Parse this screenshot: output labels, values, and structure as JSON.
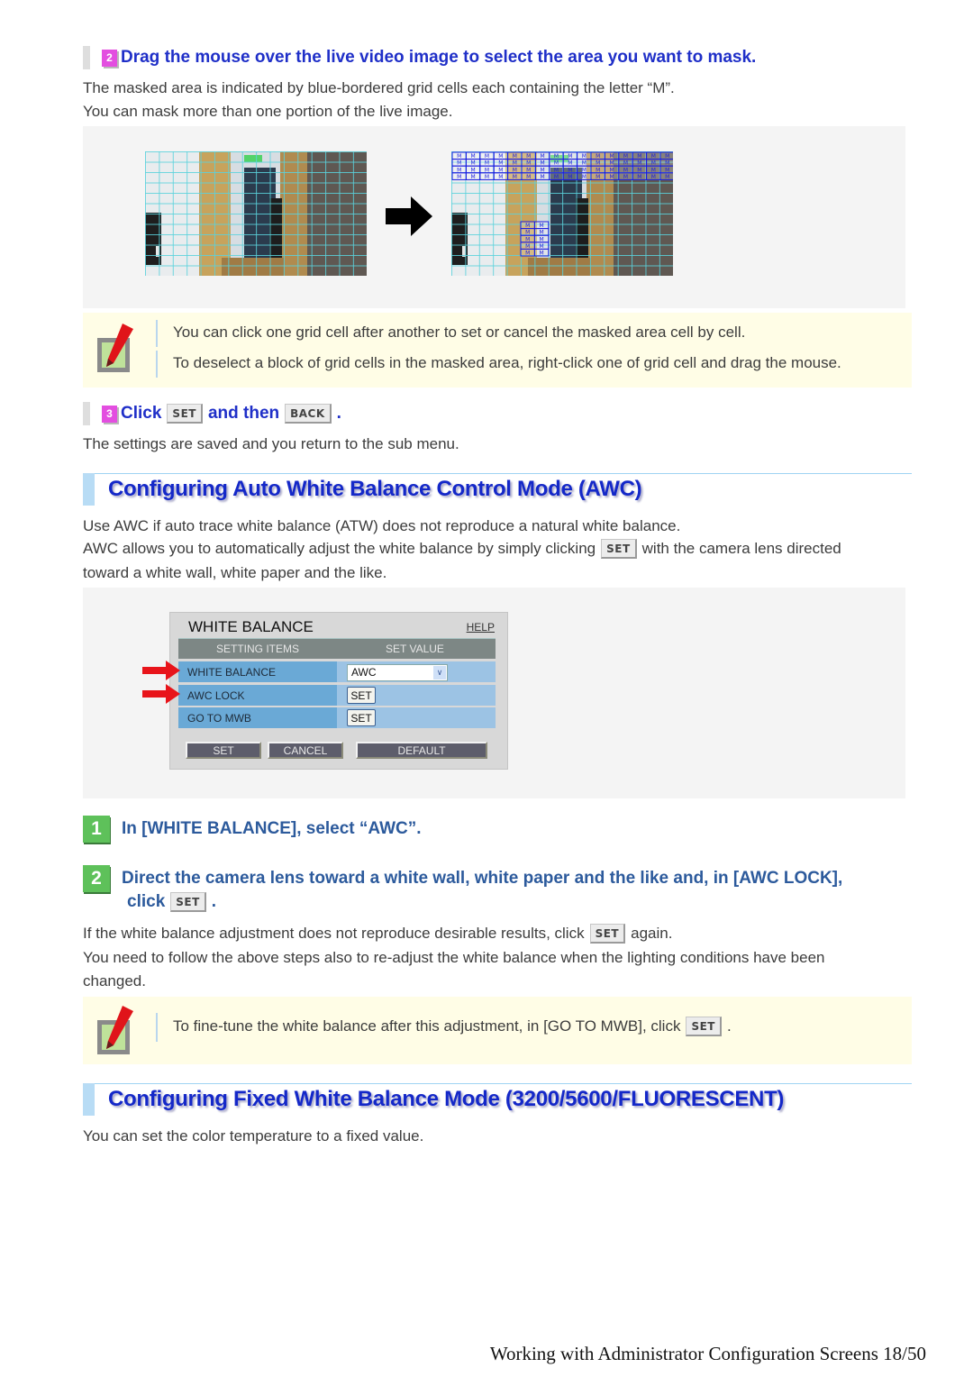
{
  "substep2": {
    "badge": "2",
    "title": "Drag the mouse over the live video image to select the area you want to mask.",
    "para": [
      "The masked area is indicated by blue-bordered grid cells each containing the letter “M”.",
      "You can mask more than one portion of the live image."
    ]
  },
  "mask_figure": {
    "before_label": "live-image-grid",
    "arrow": "right-arrow-icon",
    "after_label": "live-image-masked",
    "mask_letter": "M"
  },
  "note1": {
    "lines": [
      "You can click one grid cell after another to set or cancel the masked area cell by cell.",
      "To deselect a block of grid cells in the masked area, right-click one of grid cell and drag the mouse."
    ]
  },
  "substep3": {
    "badge": "3",
    "pre": "Click",
    "btn1": "SET",
    "mid": "and then",
    "btn2": "BACK",
    "post": ".",
    "para": "The settings are saved and you return to the sub menu."
  },
  "section_awc": {
    "title": "Configuring Auto White Balance Control Mode (AWC)",
    "para1": "Use AWC if auto trace white balance (ATW) does not reproduce a natural white balance.",
    "para2_pre": "AWC allows you to automatically adjust the white balance by simply clicking",
    "para2_btn": "SET",
    "para2_post": "with the camera lens directed",
    "para3": "toward a white wall, white paper and the like."
  },
  "wb_panel": {
    "title": "WHITE BALANCE",
    "help": "HELP",
    "col1": "SETTING ITEMS",
    "col2": "SET VALUE",
    "rows": [
      {
        "label": "WHITE BALANCE",
        "value": "AWC"
      },
      {
        "label": "AWC LOCK",
        "button": "SET"
      },
      {
        "label": "GO TO MWB",
        "button": "SET"
      }
    ],
    "footer_buttons": [
      "SET",
      "CANCEL",
      "DEFAULT"
    ]
  },
  "steps": [
    {
      "num": "1",
      "text": "In [WHITE BALANCE], select “AWC”."
    },
    {
      "num": "2",
      "text_line1": "Direct the camera lens toward a white wall, white paper and the like and, in [AWC LOCK],",
      "text_line2_pre": "click",
      "text_line2_btn": "SET",
      "text_line2_post": "."
    }
  ],
  "after_steps": {
    "line1_pre": "If the white balance adjustment does not reproduce desirable results, click",
    "line1_btn": "SET",
    "line1_post": "again.",
    "line2": "You need to follow the above steps also to re-adjust the white balance when the lighting conditions have been",
    "line3": "changed."
  },
  "note2": {
    "pre": "To fine-tune the white balance after this adjustment, in [GO TO MWB], click",
    "btn": "SET",
    "post": "."
  },
  "section_fixed": {
    "title": "Configuring Fixed White Balance Mode (3200/5600/FLUORESCENT)",
    "para": "You can set the color temperature to a fixed value."
  },
  "footer": {
    "text": "Working with Administrator Configuration Screens 18/50"
  },
  "colors": {
    "substep_title": "#1f2fc8",
    "section_title": "#1428c8",
    "step_text": "#2c5a9c",
    "step_badge": "#5ec15a",
    "substep_badge": "#e34ee0",
    "note_bg": "#fffde6"
  }
}
